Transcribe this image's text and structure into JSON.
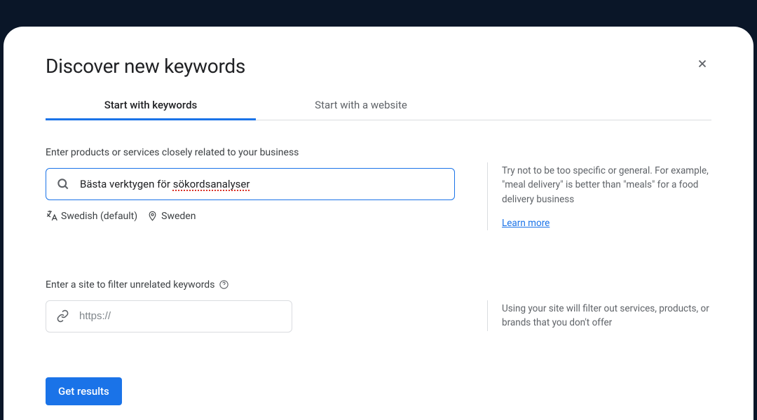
{
  "title": "Discover new keywords",
  "tabs": {
    "keywords": "Start with keywords",
    "website": "Start with a website"
  },
  "keywords_section": {
    "label": "Enter products or services closely related to your business",
    "input_prefix": "Bästa verktygen för ",
    "input_spellcheck": "sökordsanalyser",
    "language_label": "Swedish (default)",
    "location_label": "Sweden",
    "hint": "Try not to be too specific or general. For example, \"meal delivery\" is better than \"meals\" for a food delivery business",
    "learn_more": "Learn more"
  },
  "site_section": {
    "label": "Enter a site to filter unrelated keywords",
    "placeholder": "https://",
    "hint": "Using your site will filter out services, products, or brands that you don't offer"
  },
  "cta": "Get results"
}
